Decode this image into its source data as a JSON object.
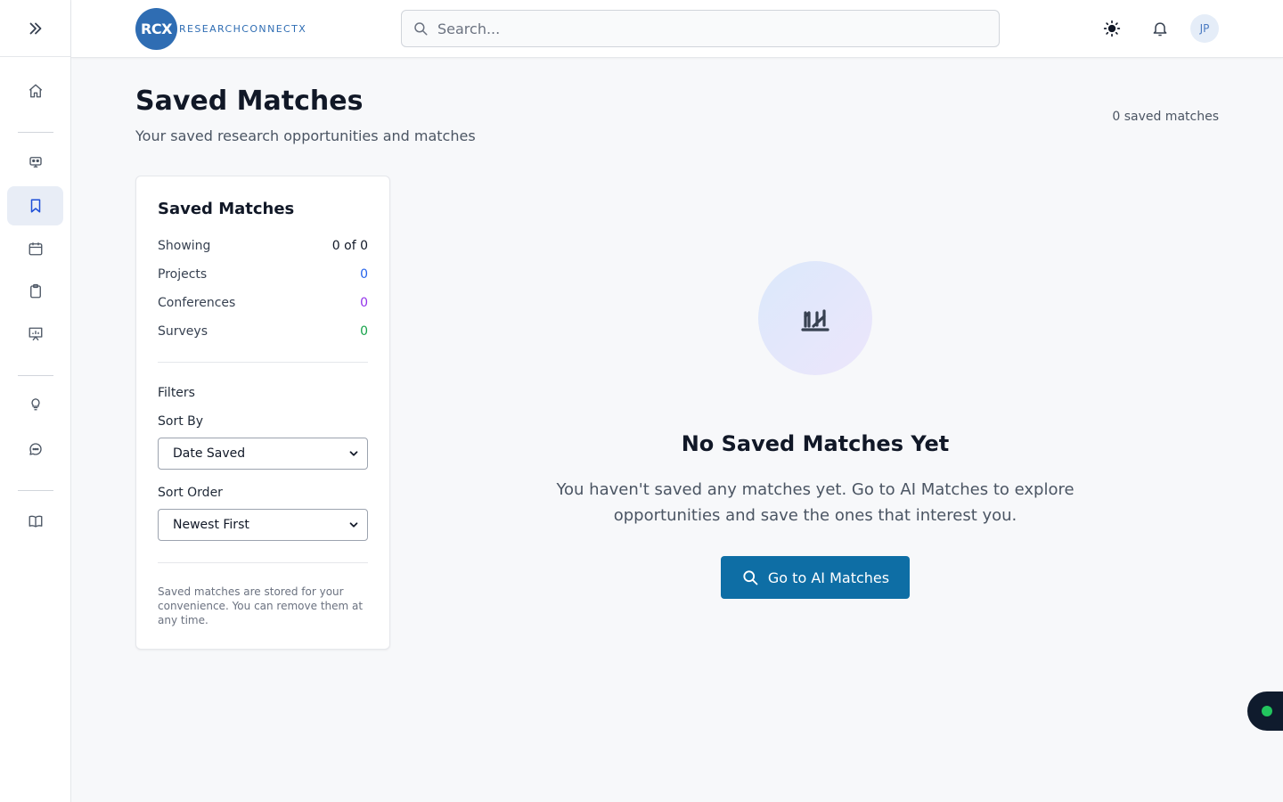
{
  "app": {
    "logo_mark": "RCX",
    "logo_text": "RESEARCHCONNECTX"
  },
  "search": {
    "placeholder": "Search..."
  },
  "user": {
    "initials": "JP"
  },
  "sidebar": {
    "items": [
      {
        "name": "home",
        "icon": "home-icon"
      },
      {
        "name": "ai-matches",
        "icon": "robot-icon"
      },
      {
        "name": "saved-matches",
        "icon": "bookmark-icon",
        "active": true
      },
      {
        "name": "calendar",
        "icon": "calendar-icon"
      },
      {
        "name": "surveys",
        "icon": "clipboard-icon"
      },
      {
        "name": "presentations",
        "icon": "presentation-icon"
      },
      {
        "name": "tips",
        "icon": "lightbulb-icon"
      },
      {
        "name": "messages",
        "icon": "chat-icon"
      },
      {
        "name": "guide",
        "icon": "book-icon"
      }
    ]
  },
  "header": {
    "title": "Saved Matches",
    "subtitle": "Your saved research opportunities and matches",
    "count_text": "0 saved matches"
  },
  "summary": {
    "title": "Saved Matches",
    "showing_label": "Showing",
    "showing_value": "0 of 0",
    "projects_label": "Projects",
    "projects_value": "0",
    "conferences_label": "Conferences",
    "conferences_value": "0",
    "surveys_label": "Surveys",
    "surveys_value": "0",
    "filters_label": "Filters",
    "sort_by_label": "Sort By",
    "sort_by_value": "Date Saved",
    "sort_order_label": "Sort Order",
    "sort_order_value": "Newest First",
    "note": "Saved matches are stored for your convenience. You can remove them at any time."
  },
  "empty_state": {
    "icon": "chart-icon",
    "title": "No Saved Matches Yet",
    "text": "You haven't saved any matches yet. Go to AI Matches to explore opportunities and save the ones that interest you.",
    "button_label": "Go to AI Matches"
  },
  "colors": {
    "brand": "#2f6db3",
    "cta": "#0e6ea5",
    "projects": "#2563eb",
    "conferences": "#9333ea",
    "surveys": "#16a34a",
    "online": "#22c55e"
  }
}
